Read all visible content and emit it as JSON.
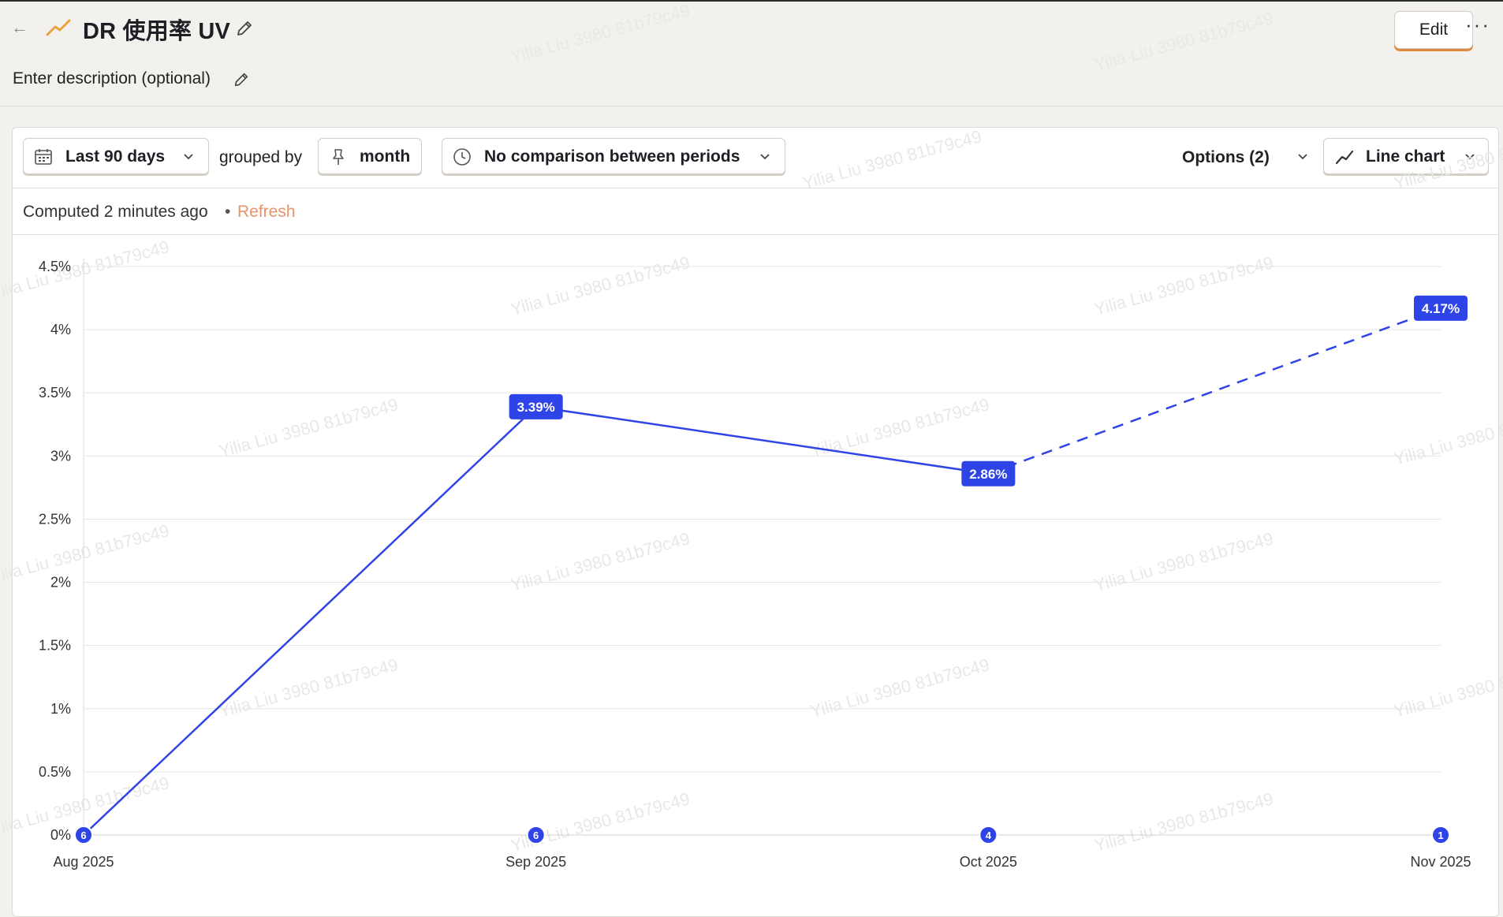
{
  "header": {
    "back_icon": "arrow-left-icon",
    "insight_icon": "trend-icon",
    "title": "DR 使用率 UV",
    "description": "Enter description (optional)",
    "edit_label": "Edit",
    "more_label": "···"
  },
  "toolbar": {
    "date_range": "Last 90 days",
    "grouped_by_label": "grouped by",
    "interval": "month",
    "comparison": "No comparison between periods",
    "options": "Options (2)",
    "chart_type": "Line chart"
  },
  "status": {
    "computed": "Computed 2 minutes ago",
    "separator": "•",
    "refresh": "Refresh"
  },
  "watermark": "Yilia Liu 3980 81b79c49",
  "colors": {
    "series": "#2f44e6",
    "accent": "#e0893d",
    "refresh": "#e8936b"
  },
  "chart_data": {
    "type": "line",
    "x": [
      "Aug 2025",
      "Sep 2025",
      "Oct 2025",
      "Nov 2025"
    ],
    "series": [
      {
        "values": [
          0,
          3.39,
          2.86,
          4.17
        ],
        "labels": [
          "",
          "3.39%",
          "2.86%",
          "4.17%"
        ],
        "counts": [
          "6",
          "6",
          "4",
          "1"
        ],
        "incomplete_from_index": 2
      }
    ],
    "yticks": [
      "0%",
      "0.5%",
      "1%",
      "1.5%",
      "2%",
      "2.5%",
      "3%",
      "3.5%",
      "4%",
      "4.5%"
    ],
    "ylim": [
      0,
      4.5
    ],
    "grid": true
  }
}
